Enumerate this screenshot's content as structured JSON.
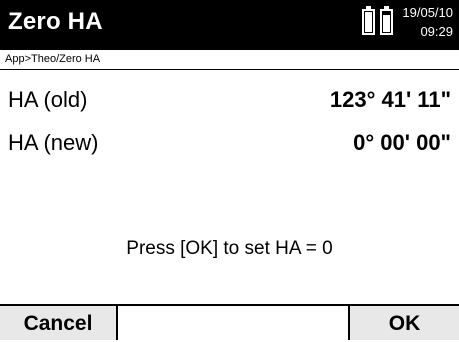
{
  "header": {
    "title": "Zero HA",
    "date": "19/05/10",
    "time": "09:29",
    "battery_icons": [
      "battery-icon",
      "battery-icon"
    ]
  },
  "breadcrumb": "App>Theo/Zero HA",
  "rows": [
    {
      "label": "HA (old)",
      "value": "123° 41' 11\""
    },
    {
      "label": "HA (new)",
      "value": "0° 00' 00\""
    }
  ],
  "message": "Press [OK] to set HA = 0",
  "softkeys": {
    "left": "Cancel",
    "middle": "",
    "right": "OK"
  }
}
